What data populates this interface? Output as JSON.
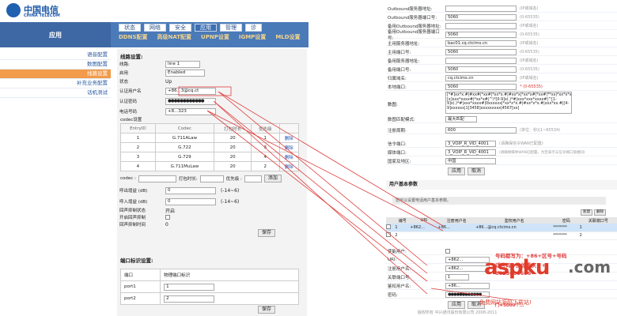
{
  "header": {
    "logo_cn": "中国电信",
    "logo_en": "CHINA TELECOM",
    "section": "应用",
    "tabs": [
      "状态",
      "网络",
      "安全",
      "应用",
      "管理",
      "诊"
    ],
    "subtabs": [
      "DDNS配置",
      "高级NAT配置",
      "UPNP设置",
      "IGMP设置",
      "MLD设置"
    ]
  },
  "sidebar": {
    "items": [
      "语音配置",
      "数图配置",
      "线路设置",
      "补充业务配置",
      "话机测试"
    ],
    "active_index": 2
  },
  "line": {
    "title": "线路设置:",
    "line_label": "线路:",
    "line_value": "line 1",
    "enable_label": "启用",
    "enable_value": "Enabled",
    "status_label": "状态",
    "status_value": "Up",
    "auth_user_label": "认证用户名",
    "auth_user_value": "+86...3@cq.ct",
    "auth_pass_label": "认证密码",
    "auth_pass_value": "●●●●●●●●●●●●",
    "phone_label": "电话号码",
    "phone_value": "+8...323",
    "codec_title": "codec设置",
    "codec_headers": [
      "EntryID",
      "Codec",
      "打包时长",
      "优先级",
      ""
    ],
    "codec_rows": [
      {
        "id": "1",
        "codec": "G.711ALaw",
        "ptime": "20",
        "prio": "1",
        "action": "删除"
      },
      {
        "id": "2",
        "codec": "G.722",
        "ptime": "20",
        "prio": "3",
        "action": "删除"
      },
      {
        "id": "3",
        "codec": "G.729",
        "ptime": "20",
        "prio": "4",
        "action": "删除"
      },
      {
        "id": "4",
        "codec": "G.711MuLaw",
        "ptime": "20",
        "prio": "2",
        "action": "删除"
      }
    ],
    "codec_bar_label": "codec :",
    "ptime_label": "打包时长:",
    "prio_label": "优先级 :",
    "add_button": "添加",
    "tx_gain_label": "呼出增益 (dB)",
    "tx_gain_value": "0",
    "tx_gain_range": "(-14~6)",
    "rx_gain_label": "呼入增益 (dB)",
    "rx_gain_value": "0",
    "rx_gain_range": "(-14~6)",
    "echo_label": "回声抑制状态",
    "echo_value": "开启",
    "echo_enable_label": "开启回声抑制",
    "echo_time_label": "回声抑制时间",
    "echo_time_value": "0",
    "save_button": "保存"
  },
  "port": {
    "title": "端口标识设置:",
    "headers": [
      "端口",
      "物理端口标识"
    ],
    "rows": [
      {
        "port": "port1",
        "value": "1"
      },
      {
        "port": "port2",
        "value": "2"
      }
    ],
    "save_button": "保存"
  },
  "right": {
    "rows": [
      {
        "label": "Outbound服务器地址:",
        "value": "",
        "hint": "(IP或域名)"
      },
      {
        "label": "Outbound服务器端口号:",
        "value": "5060",
        "hint": "(0-65535)"
      },
      {
        "label": "备用Outbound服务器地址:",
        "value": "",
        "hint": "(IP或域名)"
      },
      {
        "label": "备用Outbound服务器端口号:",
        "value": "5060",
        "hint": "(0-65535)"
      },
      {
        "label": "主用服务器地址:",
        "value": "bac01.cq.ctcims.cn",
        "hint": "(IP或域名)"
      },
      {
        "label": "主用端口号:",
        "value": "5060",
        "hint": "(0-65535)"
      },
      {
        "label": "备用服务器地址:",
        "value": "",
        "hint": "(IP或域名)"
      },
      {
        "label": "备用端口号:",
        "value": "5060",
        "hint": "(0-65535)"
      },
      {
        "label": "归属域名:",
        "value": "cq.ctcims.cn",
        "hint": "(IP或域名)"
      },
      {
        "label": "本地端口:",
        "value": "5060",
        "hint": "* (0-65535)"
      }
    ],
    "dialmap_label": "数图:",
    "dialmap_text": "[*#]xx*x.#|#xx#|*xx#|*xx*x.#|#xx*x|*xx*x#|*xx#|**xx|*xx*x*x.#|[x]xxx*xxxx#|*xx*x#|^\\*[0-9]x(.)*#|xxx*xxx*xxxx#|^[1-9]x(.)*#|xxx*xxxx#|0xxxxxx|*xx*x*x.#|#xx*x*x.#|xxx*xx.#|[4-9]xxxxxx|1[3458]xxxxxxxxx|4567[xx]",
    "dialmode_label": "数图匹配模式:",
    "dialmode_value": "最大匹配",
    "reg_period_label": "注册周期:",
    "reg_period_value": "600",
    "reg_period_hint": "(单位：秒)(1~65534)",
    "sig_port_label": "信令端口:",
    "sig_port_value": "3_VOIP_R_VID_4001",
    "sig_port_hint": "(请确保信令WAN已配置)",
    "media_port_label": "媒体端口:",
    "media_port_value": "3_VOIP_R_VID_4001",
    "media_port_hint": "(请确保媒体WAN已配置，为空表示与信令端口值相同)",
    "country_label": "国家及地区:",
    "country_value": "中国",
    "apply_button": "应用",
    "cancel_button": "取消",
    "ua_section": "用户基本参数",
    "ua_hint": "您可以设置电话用户基本参数。",
    "new_button": "新建",
    "delete_button": "删除",
    "ua_headers": [
      "",
      "编号",
      "URI",
      "注册用户名",
      "鉴权用户名",
      "密码",
      "关联端口号"
    ],
    "ua_rows": [
      {
        "num": "1",
        "uri": "+862...",
        "user": "+86...",
        "auth": "+86...@cq.ctcims.cn",
        "pwd": "*******",
        "port": "1"
      },
      {
        "num": "2",
        "uri": "",
        "user": "",
        "auth": "",
        "pwd": "*******",
        "port": "2"
      }
    ],
    "form_enable_label": "使能用户:",
    "form_uri_label": "URI:",
    "form_uri_value": "+862...",
    "form_user_label": "注册用户名:",
    "form_user_value": "+862...",
    "form_port_label": "关联端口号:",
    "form_port_value": "1",
    "form_auth_label": "鉴权用户名:",
    "form_auth_value": "+86...",
    "form_pwd_label": "密码:",
    "form_pwd_value": "●●●●●●●●●●●●",
    "form_apply": "应用",
    "form_cancel": "取消",
    "footer": "版权所有 中兴通讯股份有限公司 2008-2011"
  },
  "annotation": {
    "line1": "号码都写为：+86+区号+号码",
    "line2": "话号码，比如重庆：+",
    "line3": "8623666666",
    "line4": "门+5000个…"
  },
  "watermark": {
    "logo": "aspku",
    "net": ".com",
    "sub": "免费网站源码下载站!"
  },
  "colors": {
    "accent": "#4a7ab8",
    "active": "#f29b4a",
    "note": "#e03c3c"
  }
}
